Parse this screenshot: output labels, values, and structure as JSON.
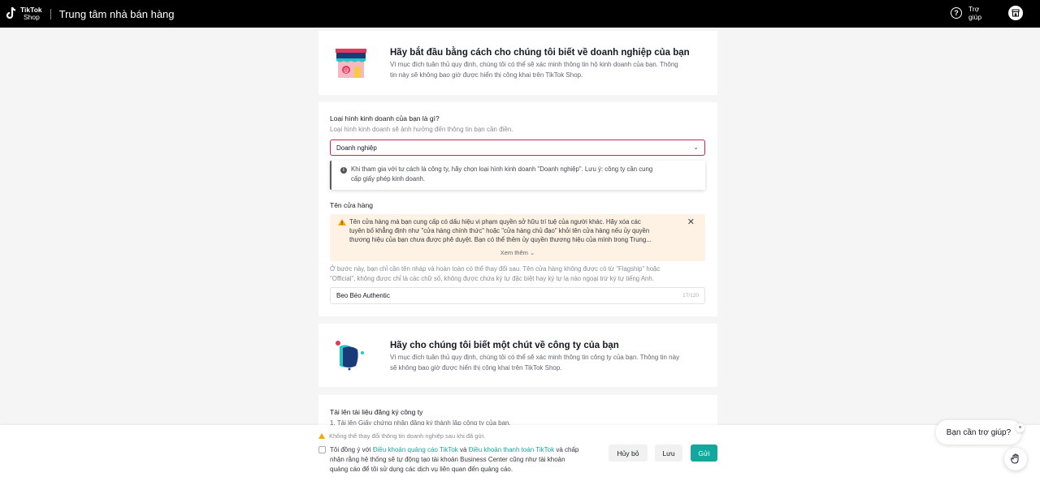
{
  "header": {
    "logo_line1": "TikTok",
    "logo_line2": "Shop",
    "title": "Trung tâm nhà bán hàng",
    "help_line1": "Trợ",
    "help_line2": "giúp"
  },
  "business_intro": {
    "title": "Hãy bắt đầu bằng cách cho chúng tôi biết về doanh nghiệp của bạn",
    "desc_line1": "Vì mục đích tuân thủ quy định, chúng tôi có thể sẽ xác minh thông tin hộ kinh doanh của bạn. Thông",
    "desc_line2": "tin này sẽ không bao giờ được hiển thị công khai trên TikTok Shop."
  },
  "business_type": {
    "label": "Loại hình kinh doanh của bạn là gì?",
    "sublabel": "Loại hình kinh doanh sẽ ảnh hưởng đến thông tin bạn cần điền.",
    "selected": "Doanh nghiệp",
    "info_line1": "Khi tham gia với tư cách là công ty, hãy chọn loại hình kinh doanh \"Doanh nghiệp\". Lưu ý: công ty cần cung",
    "info_line2": "cấp giấy phép kinh doanh."
  },
  "store_name": {
    "label": "Tên cửa hàng",
    "warn_line1": "Tên cửa hàng mà bạn cung cấp có dấu hiệu vi phạm quyền sở hữu trí tuệ của người khác. Hãy xóa các",
    "warn_line2": "tuyên bố khẳng định như \"cửa hàng chính thức\" hoặc \"cửa hàng chủ đạo\" khỏi tên cửa hàng nếu ủy quyền",
    "warn_line3": "thương hiệu của bạn chưa được phê duyệt. Bạn có thể thêm ủy quyền thương hiệu của mình trong Trung...",
    "see_more": "Xem thêm",
    "hint_line1": "Ở bước này, bạn chỉ cần tên nháp và hoàn toàn có thể thay đổi sau. Tên cửa hàng không được có từ \"Flagship\" hoặc",
    "hint_line2": "\"Official\", không được chỉ là các chữ số, không được chứa ký tự đặc biệt hay ký tự lạ nào ngoại trừ ký tự tiếng Anh.",
    "value": "Beo Béo Authentic",
    "counter": "17/120"
  },
  "company_intro": {
    "title": "Hãy cho chúng tôi biết một chút về công ty của bạn",
    "desc_line1": "Vì mục đích tuân thủ quy định, chúng tôi có thể sẽ xác minh thông tin công ty của bạn. Thông tin này",
    "desc_line2": "sẽ không bao giờ được hiển thị công khai trên TikTok Shop."
  },
  "upload": {
    "label": "Tải lên tài liệu đăng ký công ty",
    "item1": "1. Tải lên Giấy chứng nhận đăng ký thành lập công ty của bạn."
  },
  "footer": {
    "warning": "Không thể thay đổi thông tin doanh nghiệp sau khi đã gửi.",
    "agree_prefix": "Tôi đồng ý với ",
    "ads_terms": "Điều khoản quảng cáo TikTok",
    "and": " và ",
    "payment_terms": "Điều khoản thanh toán TikTok",
    "agree_rest1": " và chấp",
    "agree_rest2": "nhận rằng hệ thống sẽ tự động tạo tài khoản Business Center cũng như tài khoản",
    "agree_rest3": "quảng cáo để tôi sử dụng các dịch vụ liên quan đến quảng cáo.",
    "cancel": "Hủy bỏ",
    "save": "Lưu",
    "submit": "Gửi"
  },
  "help_widget": {
    "bubble": "Bạn cần trợ giúp?",
    "close": "×"
  },
  "colors": {
    "accent": "#13a89e",
    "select_border": "#d4224e",
    "warning_bg": "#fdf2e3"
  }
}
